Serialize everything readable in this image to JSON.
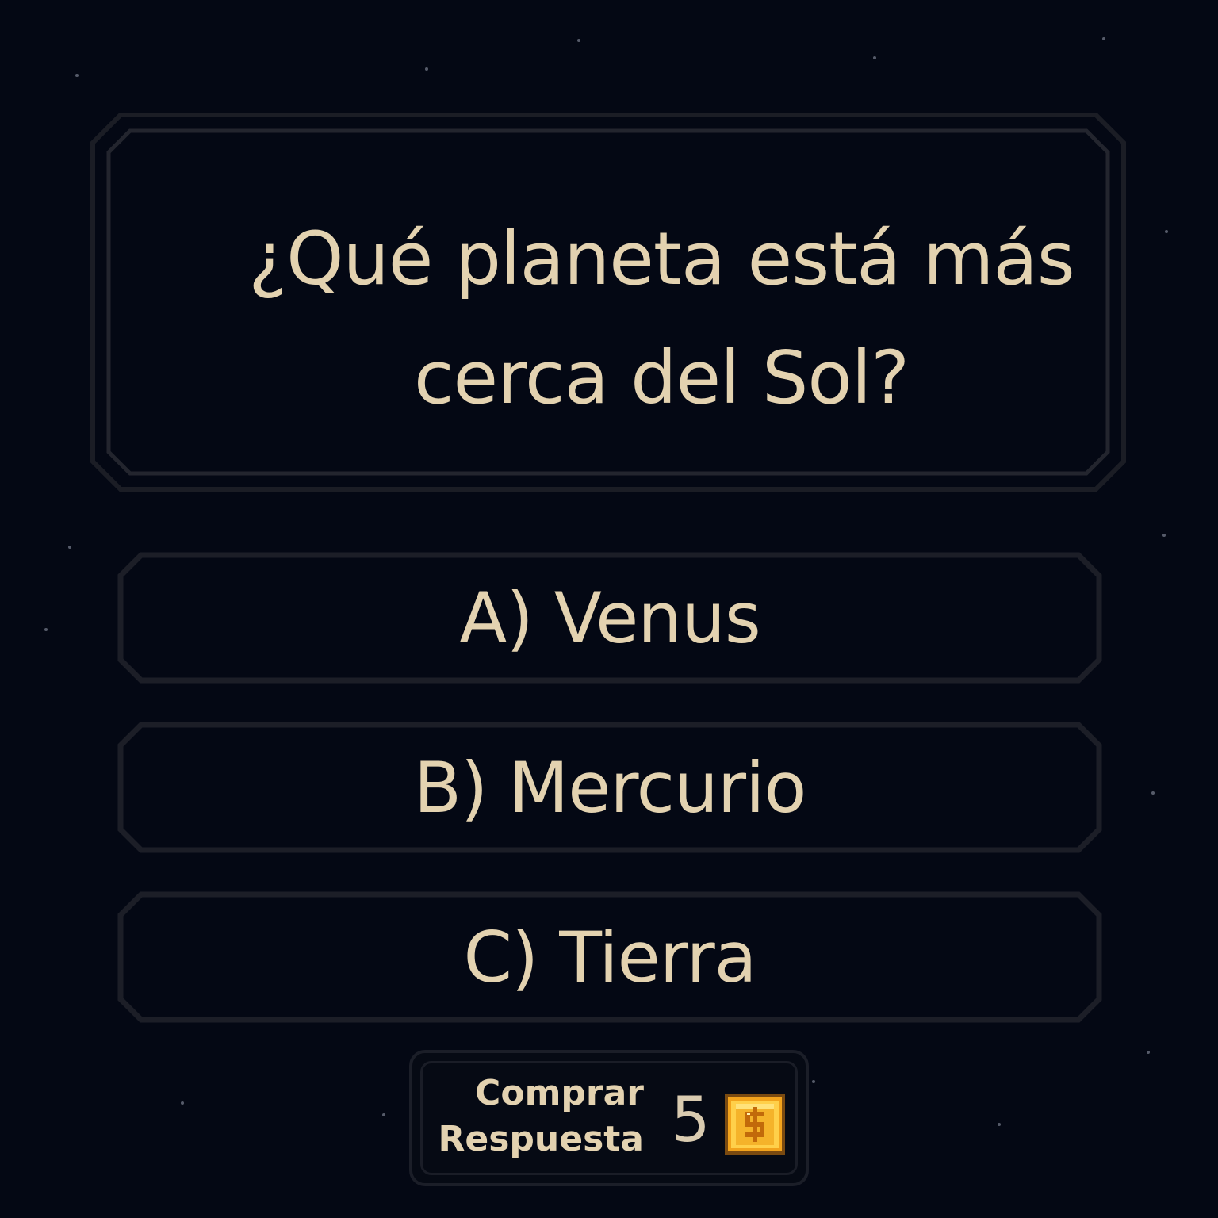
{
  "question": {
    "text": "¿Qué planeta está más cerca del Sol?"
  },
  "answers": [
    {
      "label": "A) Venus"
    },
    {
      "label": "B) Mercurio"
    },
    {
      "label": "C) Tierra"
    }
  ],
  "buy_answer": {
    "label_line1": "Comprar",
    "label_line2": "Respuesta",
    "price": "5",
    "currency_icon": "gold-coin-icon"
  },
  "colors": {
    "background": "#040814",
    "text": "#e3d2b0",
    "frame": "#1e2029",
    "coin_gold": "#f5a623"
  }
}
